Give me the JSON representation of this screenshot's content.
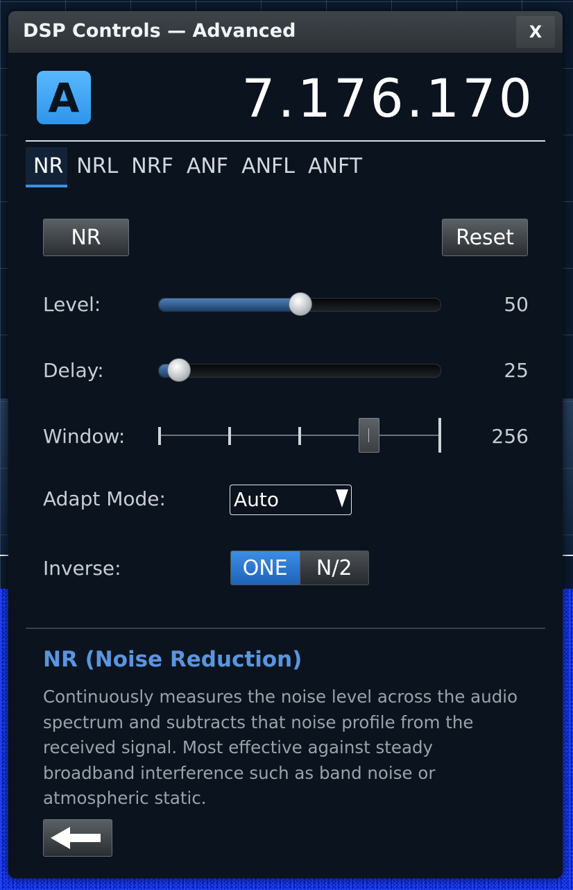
{
  "window": {
    "title": "DSP Controls — Advanced",
    "close_label": "X"
  },
  "vfo": {
    "badge": "A",
    "frequency": "7.176.170"
  },
  "tabs": [
    {
      "label": "NR",
      "active": true
    },
    {
      "label": "NRL",
      "active": false
    },
    {
      "label": "NRF",
      "active": false
    },
    {
      "label": "ANF",
      "active": false
    },
    {
      "label": "ANFL",
      "active": false
    },
    {
      "label": "ANFT",
      "active": false
    }
  ],
  "controls": {
    "toggle_label": "NR",
    "reset_label": "Reset",
    "level": {
      "label": "Level:",
      "value": "50",
      "fraction": 0.5
    },
    "delay": {
      "label": "Delay:",
      "value": "25",
      "fraction": 0.07
    },
    "window": {
      "label": "Window:",
      "value": "256",
      "step_index": 3,
      "step_count": 5
    },
    "adapt_mode": {
      "label": "Adapt Mode:",
      "selected": "Auto"
    },
    "inverse": {
      "label": "Inverse:",
      "options": [
        "ONE",
        "N/2"
      ],
      "selected_index": 0
    }
  },
  "help": {
    "title": "NR (Noise Reduction)",
    "body": "Continuously measures the noise level across the audio spectrum and subtracts that noise profile from the received signal. Most effective against steady broadband interference such as band noise or atmospheric static."
  },
  "colors": {
    "accent": "#3c8fe0",
    "badge": "#3fa4f2",
    "help_title": "#5a95de"
  },
  "icons": {
    "back": "arrow-left-icon",
    "dropdown": "triangle-down-icon"
  }
}
